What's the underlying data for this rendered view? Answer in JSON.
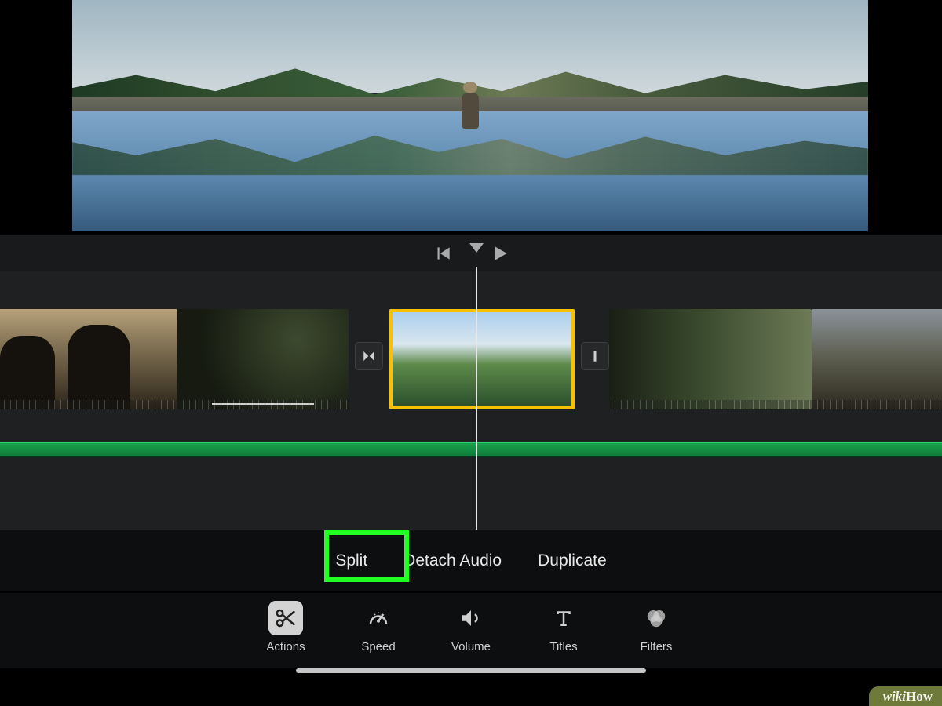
{
  "transport": {
    "prev_icon": "skip-back",
    "play_icon": "play"
  },
  "clip_menu": {
    "split": "Split",
    "detach": "Detach Audio",
    "duplicate": "Duplicate"
  },
  "tools": {
    "actions": "Actions",
    "speed": "Speed",
    "volume": "Volume",
    "titles": "Titles",
    "filters": "Filters"
  },
  "watermark_a": "wiki",
  "watermark_b": "How"
}
